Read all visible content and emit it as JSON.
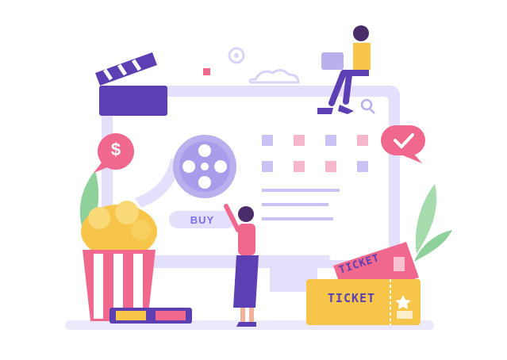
{
  "illustration": {
    "buy_label": "BUY",
    "ticket_front_label": "TICKET",
    "ticket_back_label": "TICKET",
    "currency_symbol": "$",
    "colors": {
      "purple": "#7c5cd6",
      "lavender": "#d9d4f7",
      "pink": "#f0688e",
      "yellow": "#f6c54a",
      "green": "#6fc37a"
    }
  }
}
